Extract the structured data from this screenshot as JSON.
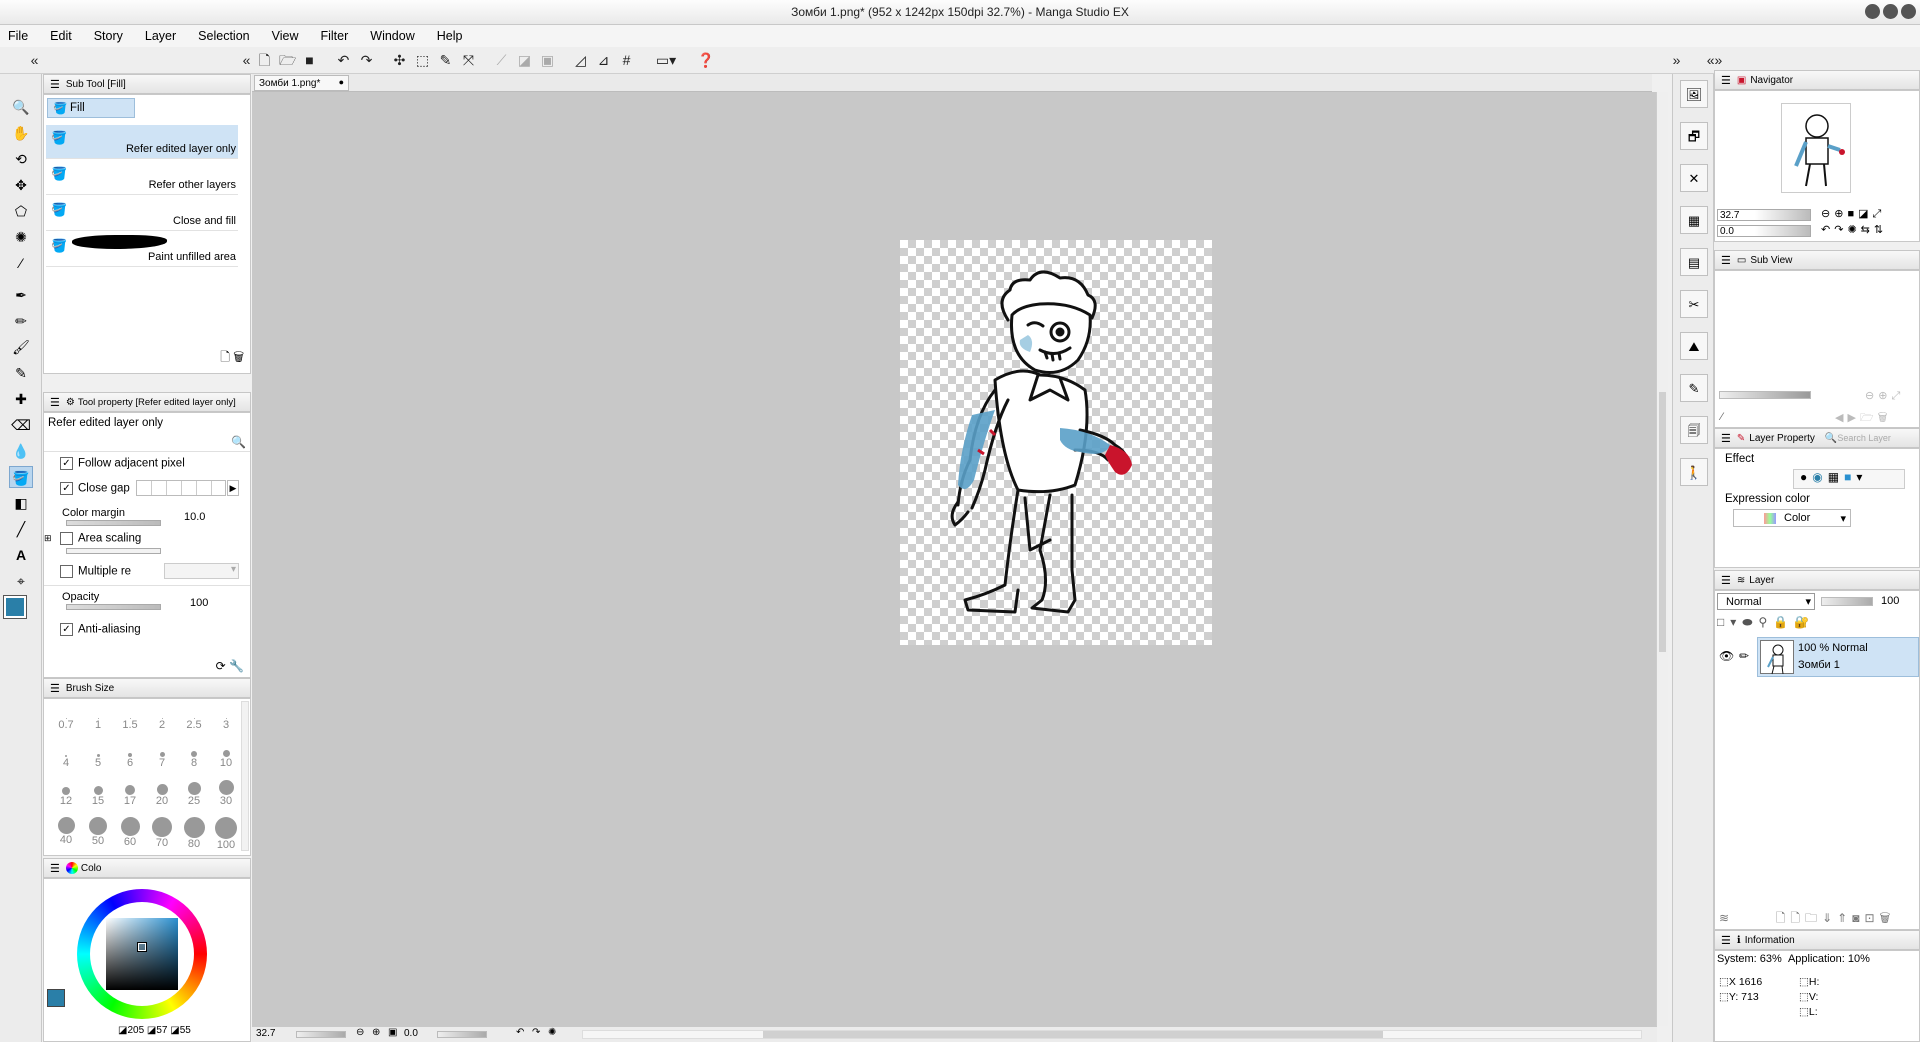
{
  "window": {
    "title": "Зомби 1.png* (952 x 1242px 150dpi 32.7%) - Manga Studio EX"
  },
  "menu": [
    "File",
    "Edit",
    "Story",
    "Layer",
    "Selection",
    "View",
    "Filter",
    "Window",
    "Help"
  ],
  "subtool": {
    "panel_title": "Sub Tool [Fill]",
    "group": "Fill",
    "items": [
      "Refer edited layer only",
      "Refer other layers",
      "Close and fill",
      "Paint unfilled area"
    ]
  },
  "toolprop": {
    "panel_title": "Tool property [Refer edited layer only]",
    "preset_name": "Refer edited layer only",
    "follow_adjacent": "Follow adjacent pixel",
    "close_gap": "Close gap",
    "color_margin_label": "Color margin",
    "color_margin_value": "10.0",
    "area_scaling": "Area scaling",
    "multiple_ref": "Multiple re",
    "opacity_label": "Opacity",
    "opacity_value": "100",
    "anti_aliasing": "Anti-aliasing"
  },
  "brush": {
    "panel_title": "Brush Size",
    "sizes": [
      "0.7",
      "1",
      "1.5",
      "2",
      "2.5",
      "3",
      "4",
      "5",
      "6",
      "7",
      "8",
      "10",
      "12",
      "15",
      "17",
      "20",
      "25",
      "30",
      "40",
      "50",
      "60",
      "70",
      "80",
      "100"
    ]
  },
  "color": {
    "tab": "Colo",
    "r": "205",
    "g": "57",
    "b": "55",
    "main_color": "#2a7fa8",
    "sub_color": "#5fd0d0"
  },
  "document": {
    "tab": "Зомби 1.png*"
  },
  "status": {
    "zoom": "32.7",
    "angle": "0.0"
  },
  "navigator": {
    "title": "Navigator",
    "zoom": "32.7",
    "angle": "0.0"
  },
  "subview": {
    "title": "Sub View"
  },
  "layerprop": {
    "title": "Layer Property",
    "search_tab": "Search Layer",
    "effect": "Effect",
    "expression_color": "Expression color",
    "color_value": "Color"
  },
  "layer": {
    "title": "Layer",
    "blend": "Normal",
    "opacity": "100",
    "items": [
      {
        "opacity_blend": "100 % Normal",
        "name": "Зомби 1"
      }
    ]
  },
  "info": {
    "title": "Information",
    "system": "System: 63%",
    "application": "Application: 10%",
    "x": "X  1616",
    "y": "Y:  713",
    "h": "H:",
    "v": "V:",
    "l": "L:"
  }
}
